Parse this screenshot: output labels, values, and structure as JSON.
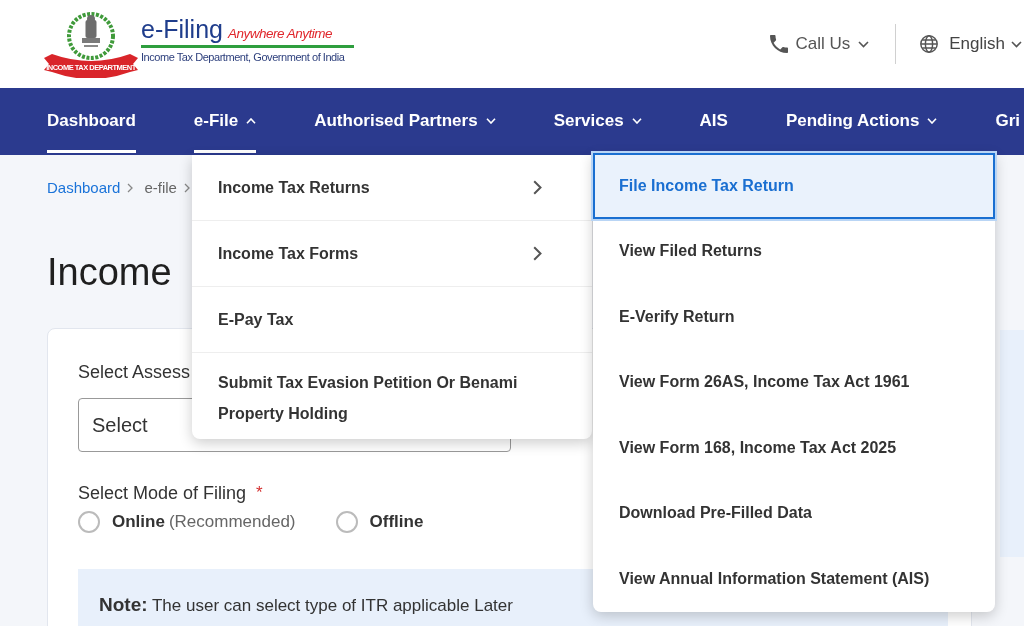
{
  "header": {
    "emblem_text": "INCOME TAX DEPARTMENT",
    "title": "e-Filing",
    "tagline": "Anywhere Anytime",
    "subtitle": "Income Tax Department, Government of India",
    "actions": [
      {
        "kind": "phone",
        "label": "Call Us"
      },
      {
        "kind": "language",
        "label": "English"
      }
    ]
  },
  "nav": [
    {
      "label": "Dashboard",
      "kind": "link",
      "selected": true
    },
    {
      "label": "e-File",
      "kind": "menu",
      "selected": true,
      "expanded": true
    },
    {
      "label": "Authorised Partners",
      "kind": "menu",
      "selected": false,
      "expanded": false
    },
    {
      "label": "Services",
      "kind": "menu",
      "selected": false,
      "expanded": false
    },
    {
      "label": "AIS",
      "kind": "link",
      "selected": false
    },
    {
      "label": "Pending Actions",
      "kind": "menu",
      "selected": false,
      "expanded": false
    },
    {
      "label": "Gri",
      "kind": "link",
      "selected": false
    }
  ],
  "breadcrumb": [
    {
      "label": "Dashboard",
      "kind": "link"
    },
    {
      "label": "e-file",
      "kind": "text"
    }
  ],
  "page_title": "Income",
  "form": {
    "assessment_year": {
      "label": "Select Assess",
      "value": "Select"
    },
    "filing_mode": {
      "label": "Select Mode of Filing",
      "required_mark": "*",
      "options": [
        {
          "label": "Online",
          "hint": "(Recommended)",
          "selected": false
        },
        {
          "label": "Offline",
          "selected": false
        }
      ]
    },
    "note": "**Note:** The user can select type of ITR applicable Later"
  },
  "efile_menu": {
    "items": [
      {
        "label": "Income Tax Returns",
        "kind": "submenu"
      },
      {
        "label": "Income Tax Forms",
        "kind": "submenu"
      },
      {
        "label": "E-Pay Tax",
        "kind": "link"
      },
      {
        "label": "Submit Tax Evasion Petition Or Benami Property Holding",
        "kind": "link"
      }
    ]
  },
  "submenu": {
    "items": [
      {
        "label": "File Income Tax Return",
        "selected": true
      },
      {
        "label": "View Filed Returns",
        "selected": false
      },
      {
        "label": "E-Verify Return",
        "selected": false
      },
      {
        "label": "View Form 26AS, Income Tax Act 1961",
        "selected": false
      },
      {
        "label": "View Form 168, Income Tax Act 2025",
        "selected": false
      },
      {
        "label": "Download Pre-Filled Data",
        "selected": false
      },
      {
        "label": "View Annual Information Statement (AIS)",
        "selected": false
      }
    ]
  }
}
